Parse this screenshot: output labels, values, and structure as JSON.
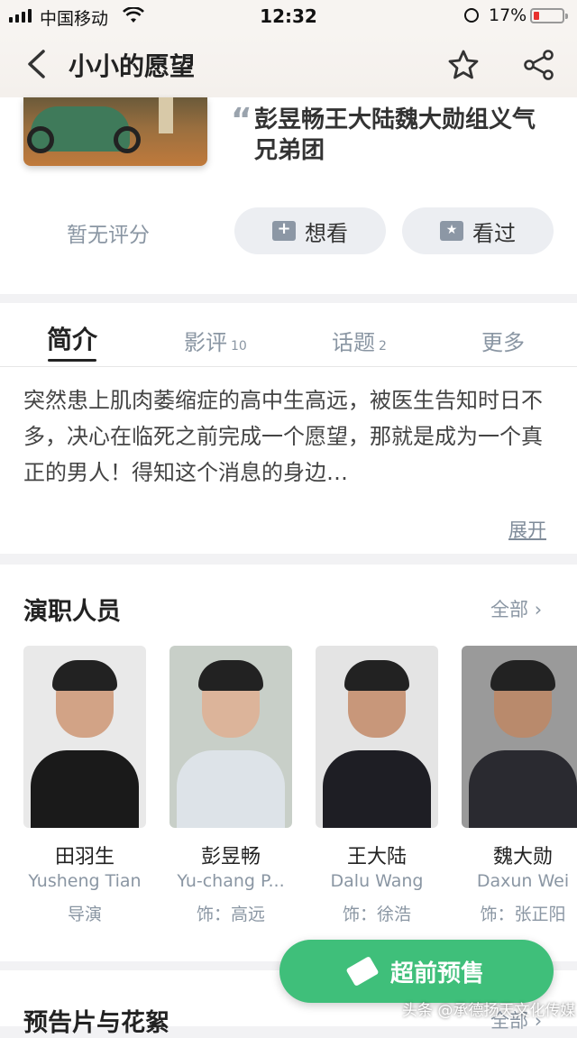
{
  "status": {
    "carrier": "中国移动",
    "time": "12:32",
    "battery": "17%"
  },
  "header": {
    "title": "小小的愿望"
  },
  "movie": {
    "quote": "彭昱畅王大陆魏大勋组义气兄弟团",
    "rating": "暂无评分",
    "want_label": "想看",
    "seen_label": "看过"
  },
  "tabs": [
    {
      "label": "简介",
      "count": ""
    },
    {
      "label": "影评",
      "count": "10"
    },
    {
      "label": "话题",
      "count": "2"
    },
    {
      "label": "更多",
      "count": ""
    }
  ],
  "synopsis": {
    "text": "突然患上肌肉萎缩症的高中生高远，被医生告知时日不多，决心在临死之前完成一个愿望，那就是成为一个真正的男人！得知这个消息的身边…",
    "expand": "展开"
  },
  "cast": {
    "title": "演职人员",
    "all": "全部",
    "people": [
      {
        "name": "田羽生",
        "en": "Yusheng Tian",
        "role": "导演"
      },
      {
        "name": "彭昱畅",
        "en": "Yu-chang P...",
        "role": "饰：高远"
      },
      {
        "name": "王大陆",
        "en": "Dalu Wang",
        "role": "饰：徐浩"
      },
      {
        "name": "魏大勋",
        "en": "Daxun Wei",
        "role": "饰：张正阳"
      }
    ]
  },
  "trailer": {
    "title": "预告片与花絮",
    "all": "全部"
  },
  "presale": {
    "label": "超前预售"
  },
  "watermark": "头条 @承德扬天文化传媒"
}
